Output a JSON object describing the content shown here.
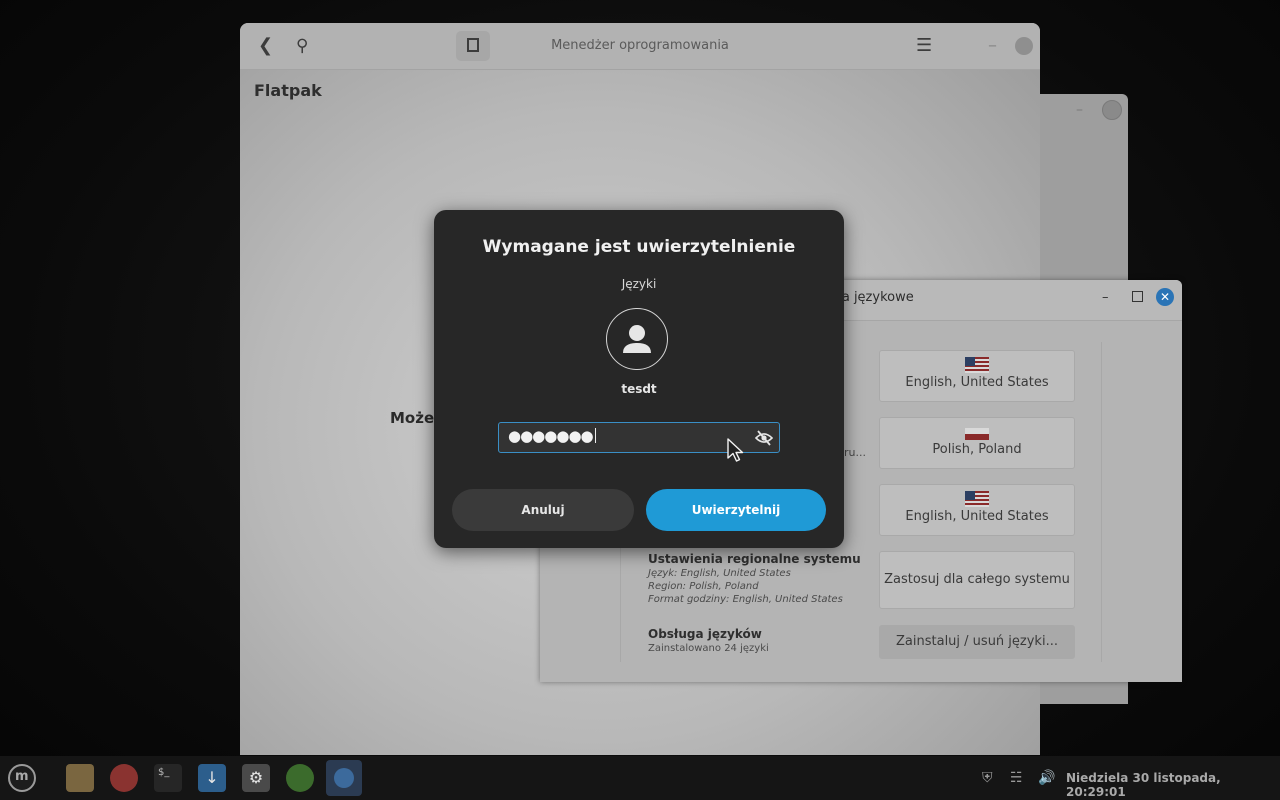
{
  "software_manager": {
    "title": "Menedżer oprogramowania",
    "section": "Flatpak",
    "partial_text": "Może"
  },
  "language_window": {
    "title_partial": "nia językowe",
    "buttons": {
      "language": "English, United States",
      "region": "Polish, Poland",
      "time_format": "English, United States",
      "apply_system": "Zastosuj dla całego systemu",
      "install_remove": "Zainstaluj / usuń języki..."
    },
    "truncated_label": "ru...",
    "system_locale": {
      "title": "Ustawienia regionalne systemu",
      "language_line": "Język: English, United States",
      "region_line": "Region: Polish, Poland",
      "time_format_line": "Format godziny: English, United States"
    },
    "language_support": {
      "title": "Obsługa języków",
      "installed": "Zainstalowano 24 języki"
    }
  },
  "auth_dialog": {
    "title": "Wymagane jest uwierzytelnienie",
    "subtitle": "Języki",
    "user": "tesdt",
    "password_mask": "●●●●●●●",
    "cancel_label": "Anuluj",
    "auth_label": "Uwierzytelnij"
  },
  "taskbar": {
    "clock": "Niedziela 30 listopada, 20:29:01"
  },
  "colors": {
    "accent": "#1f9ad6",
    "dialog_bg": "#272727",
    "field_border": "#3a8fc6"
  }
}
